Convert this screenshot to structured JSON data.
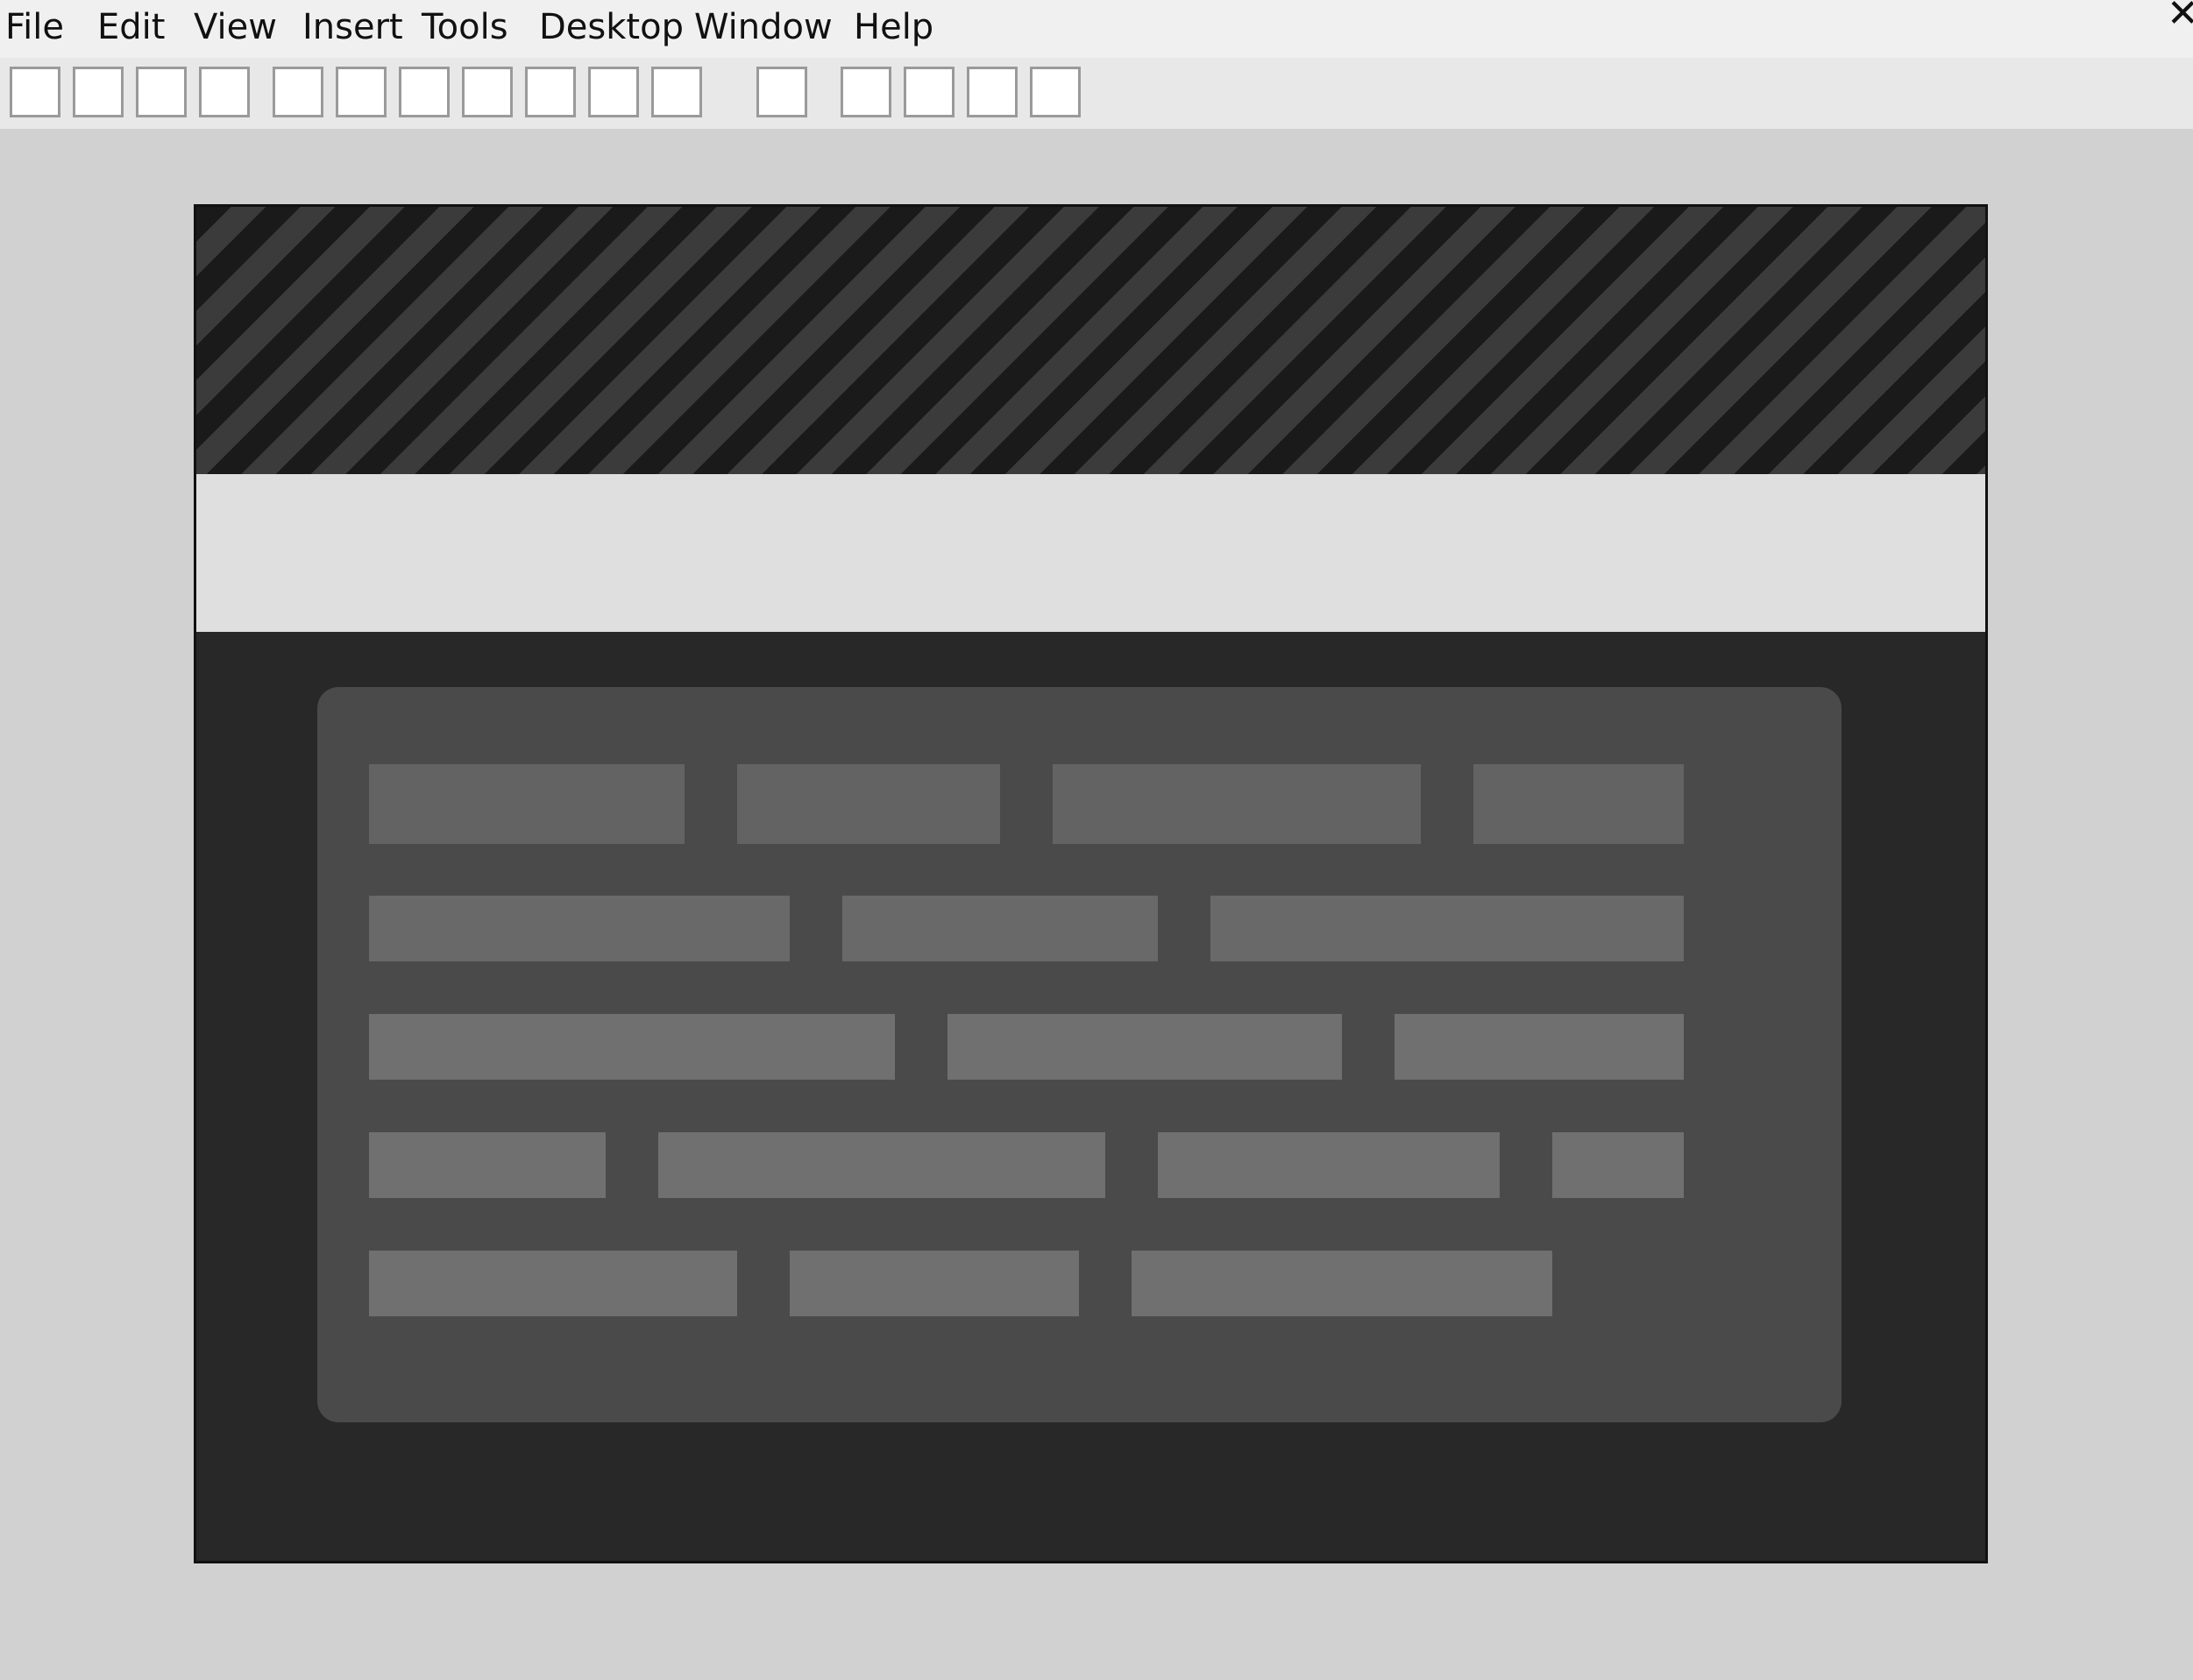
{
  "menubar": {
    "items": [
      "File",
      "Edit",
      "View",
      "Insert",
      "Tools",
      "Desktop",
      "Window",
      "Help"
    ],
    "close_icon": "close-icon"
  },
  "toolbar": {
    "button_count": 16
  },
  "figure": {
    "colors": {
      "stripe_dark": "#1a1a1a",
      "stripe_light": "#3b3b3b",
      "band": "#dfdfdf",
      "background": "#282828",
      "card": "#4a4a4a",
      "block_row1": "#636363",
      "block_row2": "#696969",
      "block_rows_3_to_5": "#707070"
    }
  }
}
